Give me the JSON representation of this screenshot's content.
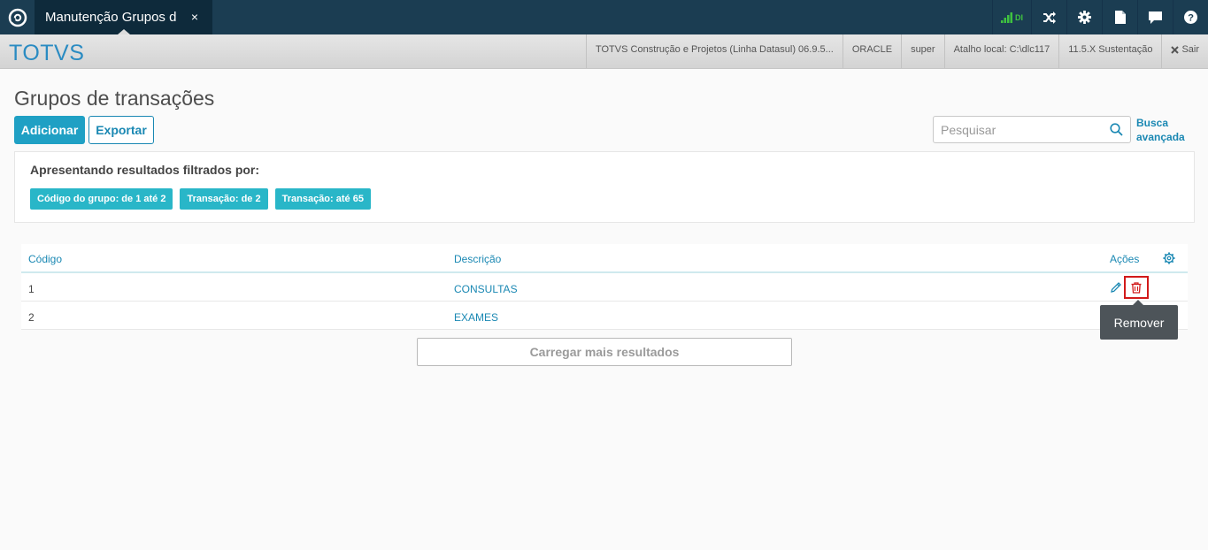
{
  "topbar": {
    "tab_title": "Manutenção Grupos d",
    "tab_close": "×",
    "signal_label": "DI",
    "icons": [
      "signal-icon",
      "shuffle-icon",
      "gear-icon",
      "document-icon",
      "chat-icon",
      "help-icon"
    ]
  },
  "subbar": {
    "brand": "TOTVS",
    "product": "TOTVS Construção e Projetos (Linha Datasul) 06.9.5...",
    "database": "ORACLE",
    "user": "super",
    "shortcut": "Atalho local: C:\\dlc117",
    "version": "11.5.X Sustentação",
    "exit": "Sair"
  },
  "page": {
    "title": "Grupos de transações",
    "add_button": "Adicionar",
    "export_button": "Exportar",
    "search_placeholder": "Pesquisar",
    "advanced_search": "Busca avançada"
  },
  "filters": {
    "title": "Apresentando resultados filtrados por:",
    "chips": [
      "Código do grupo: de 1 até 2",
      "Transação: de 2",
      "Transação: até 65"
    ]
  },
  "table": {
    "columns": {
      "code": "Código",
      "description": "Descrição",
      "actions": "Ações"
    },
    "rows": [
      {
        "code": "1",
        "description": "CONSULTAS"
      },
      {
        "code": "2",
        "description": "EXAMES"
      }
    ],
    "load_more": "Carregar mais resultados"
  },
  "tooltip": {
    "text": "Remover"
  },
  "colors": {
    "topbar": "#1b3d52",
    "accent": "#1fa0c4",
    "chip": "#29b6c8",
    "highlight": "#d21a1a"
  }
}
